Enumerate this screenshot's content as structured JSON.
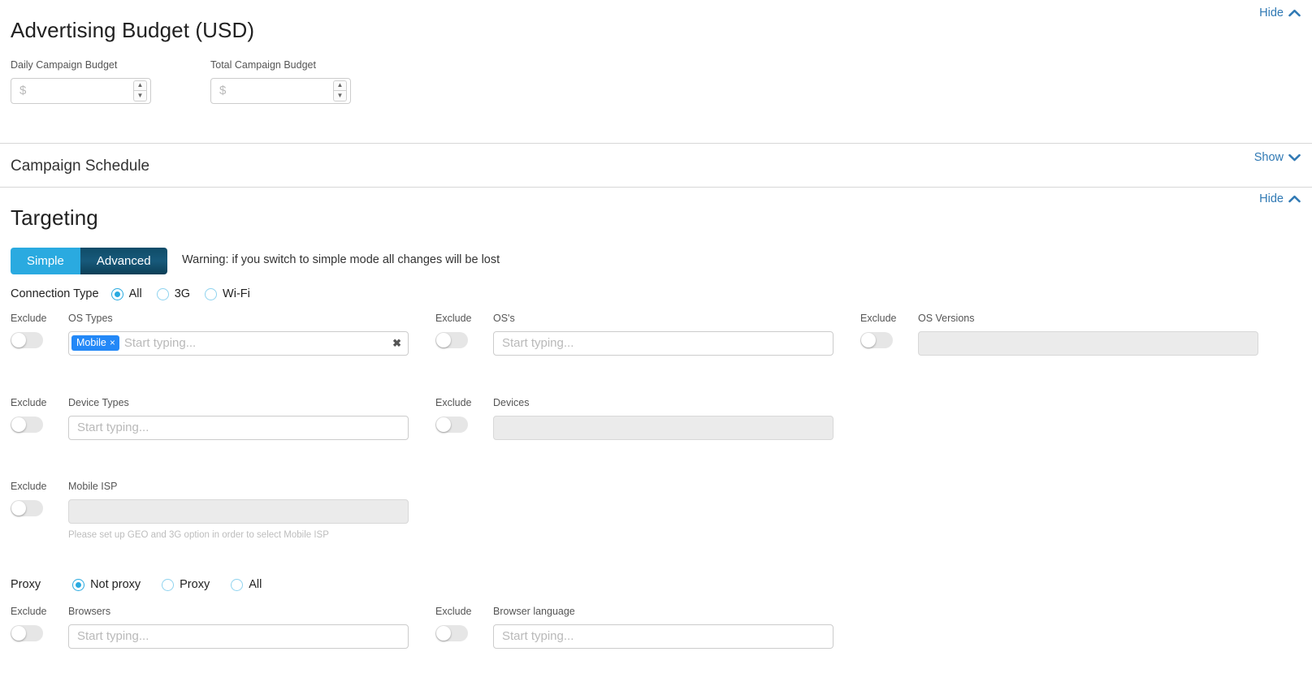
{
  "sections": {
    "budget": {
      "title": "Advertising Budget (USD)",
      "toggle_label": "Hide",
      "toggle_state": "up",
      "fields": {
        "daily": {
          "label": "Daily Campaign Budget",
          "value": "",
          "placeholder": "$"
        },
        "total": {
          "label": "Total Campaign Budget",
          "value": "",
          "placeholder": "$"
        }
      }
    },
    "schedule": {
      "title": "Campaign Schedule",
      "toggle_label": "Show",
      "toggle_state": "down"
    },
    "targeting": {
      "title": "Targeting",
      "toggle_label": "Hide",
      "toggle_state": "up",
      "mode": {
        "simple_label": "Simple",
        "advanced_label": "Advanced",
        "active": "Advanced",
        "warning": "Warning: if you switch to simple mode all changes will be lost"
      },
      "connection_type": {
        "label": "Connection Type",
        "options": [
          {
            "label": "All",
            "checked": true
          },
          {
            "label": "3G",
            "checked": false
          },
          {
            "label": "Wi-Fi",
            "checked": false
          }
        ]
      },
      "proxy": {
        "label": "Proxy",
        "options": [
          {
            "label": "Not proxy",
            "checked": true
          },
          {
            "label": "Proxy",
            "checked": false
          },
          {
            "label": "All",
            "checked": false
          }
        ]
      },
      "exclude_label": "Exclude",
      "fields": {
        "os_types": {
          "label": "OS Types",
          "placeholder": "Start typing...",
          "tags": [
            {
              "label": "Mobile",
              "remove": "×"
            }
          ],
          "clear_icon": "✖",
          "disabled": false,
          "exclude_on": false
        },
        "oss": {
          "label": "OS's",
          "placeholder": "Start typing...",
          "value": "",
          "disabled": false,
          "exclude_on": false
        },
        "os_versions": {
          "label": "OS Versions",
          "placeholder": "",
          "value": "",
          "disabled": true,
          "exclude_on": false
        },
        "device_types": {
          "label": "Device Types",
          "placeholder": "Start typing...",
          "value": "",
          "disabled": false,
          "exclude_on": false
        },
        "devices": {
          "label": "Devices",
          "placeholder": "",
          "value": "",
          "disabled": true,
          "exclude_on": false
        },
        "mobile_isp": {
          "label": "Mobile ISP",
          "placeholder": "",
          "value": "",
          "disabled": true,
          "exclude_on": false,
          "help": "Please set up GEO and 3G option in order to select Mobile ISP"
        },
        "browsers": {
          "label": "Browsers",
          "placeholder": "Start typing...",
          "value": "",
          "disabled": false,
          "exclude_on": false
        },
        "browser_language": {
          "label": "Browser language",
          "placeholder": "Start typing...",
          "value": "",
          "disabled": false,
          "exclude_on": false
        }
      }
    }
  },
  "colors": {
    "link": "#3079b4",
    "accent": "#2aaae0",
    "tag": "#2388f7",
    "advanced": "#124f6b"
  }
}
